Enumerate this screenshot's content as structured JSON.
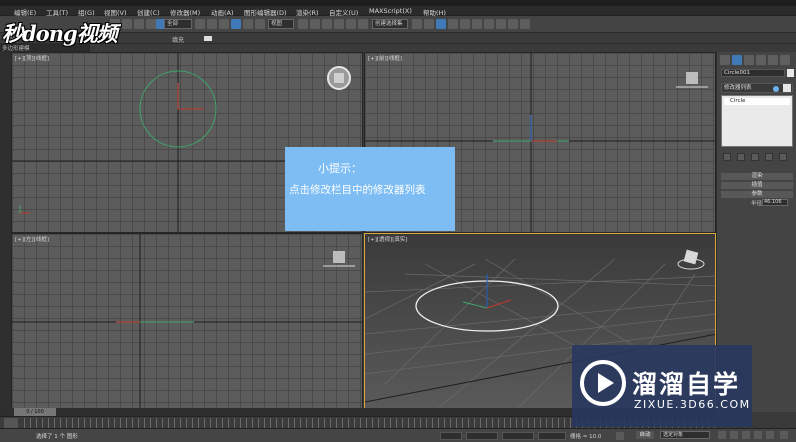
{
  "menu": [
    "编辑(E)",
    "工具(T)",
    "组(G)",
    "视图(V)",
    "创建(C)",
    "修改器(M)",
    "动画(A)",
    "图形编辑器(D)",
    "渲染(R)",
    "自定义(U)",
    "MAXScript(X)",
    "帮助(H)"
  ],
  "toolbar": {
    "filter_select": "全部",
    "view_select": "视图",
    "selection_set": "创建选择集"
  },
  "ribbon": {
    "tab_a": "建模",
    "tab_b": "填充",
    "sub": "多边形建模"
  },
  "logo": "秒dong视频",
  "viewports": {
    "top": "[+][顶][线框]",
    "front": "[+][前][线框]",
    "left": "[+][左][线框]",
    "persp": "[+][透视][真实]"
  },
  "command_panel": {
    "object_name": "Circle001",
    "modifier_list": "修改器列表",
    "stack_item": "Circle",
    "rollouts": [
      "渲染",
      "插值",
      "参数"
    ],
    "radius_label": "半径:",
    "radius_value": "46.106"
  },
  "tip": {
    "title": "小提示：",
    "body": "点击修改栏目中的修改器列表"
  },
  "timeline": {
    "frame": "0 / 100"
  },
  "status": {
    "selection": "选择了 1 个 图形",
    "grid": "栅格 = 10.0",
    "auto_key": "自动",
    "selected_object": "选定对象"
  },
  "watermark": {
    "cn": "溜溜自学",
    "en": "ZIXUE.3D66.COM"
  },
  "colors": {
    "tip_bg": "#7dbdf3",
    "active_border": "#d8a838",
    "circle": "#3fa56b"
  }
}
